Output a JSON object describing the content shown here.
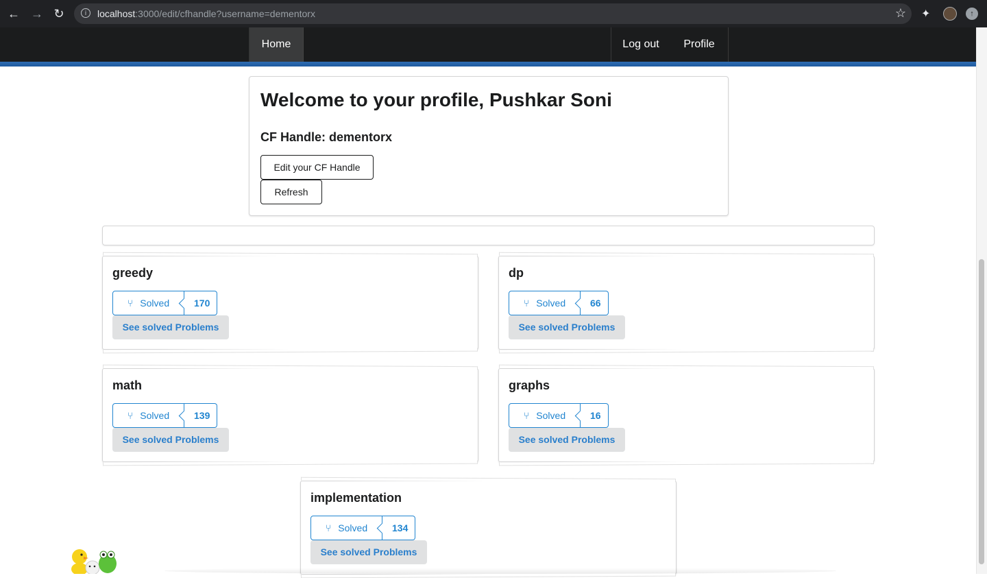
{
  "browser": {
    "url_host": "localhost",
    "url_rest": ":3000/edit/cfhandle?username=dementorx"
  },
  "nav": {
    "home": "Home",
    "logout": "Log out",
    "profile": "Profile"
  },
  "profile": {
    "welcome": "Welcome to your profile, Pushkar Soni",
    "handle": "CF Handle: dementorx",
    "edit_button": "Edit your CF Handle",
    "refresh_button": "Refresh"
  },
  "tags": [
    {
      "name": "greedy",
      "solved_label": "Solved",
      "count": "170",
      "see_label": "See solved Problems"
    },
    {
      "name": "dp",
      "solved_label": "Solved",
      "count": "66",
      "see_label": "See solved Problems"
    },
    {
      "name": "math",
      "solved_label": "Solved",
      "count": "139",
      "see_label": "See solved Problems"
    },
    {
      "name": "graphs",
      "solved_label": "Solved",
      "count": "16",
      "see_label": "See solved Problems"
    },
    {
      "name": "implementation",
      "solved_label": "Solved",
      "count": "134",
      "see_label": "See solved Problems"
    }
  ],
  "colors": {
    "accent": "#2185d0",
    "navbar": "#1b1c1d",
    "nav_accent_bar": "#2f6db2",
    "button_grey": "#e0e1e2"
  }
}
